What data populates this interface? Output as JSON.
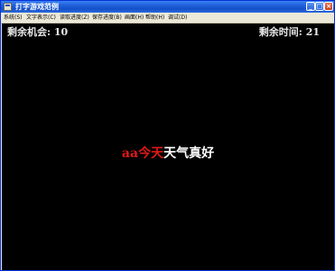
{
  "window": {
    "title": "打字游戏范例"
  },
  "title_buttons": {
    "minimize": "_",
    "maximize": "□",
    "close": "×"
  },
  "menu": [
    "系统(S)",
    "文字表示(C)",
    "读取进度(Z)",
    "保存进度(B)",
    "画面(H)",
    "帮助(H)",
    "调试(D)"
  ],
  "game": {
    "chances_label": "剩余机会:",
    "chances_value": "10",
    "time_label": "剩余时间:",
    "time_value": "21",
    "typed_text": "aa今天",
    "remaining_text": "天气真好"
  },
  "colors": {
    "background": "#000000",
    "typed": "#e01818",
    "remaining": "#ffffff",
    "titlebar": "#1f5fd8"
  }
}
